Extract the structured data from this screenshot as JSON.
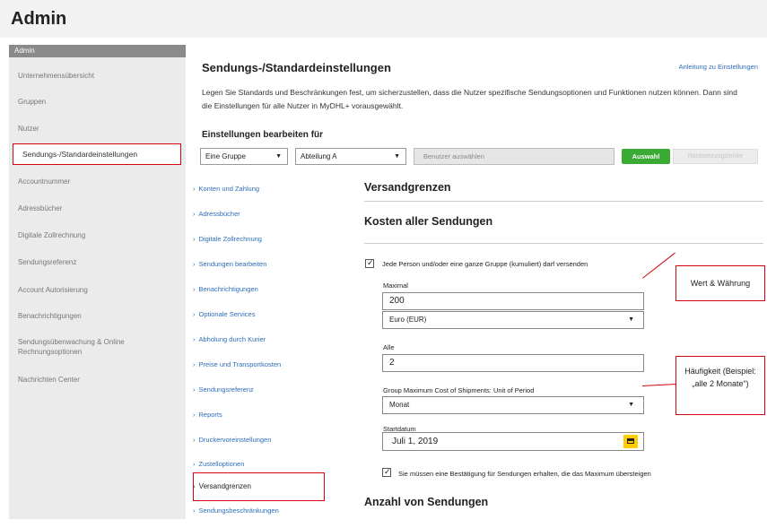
{
  "app": {
    "title": "Admin"
  },
  "sidebar": {
    "header": "Admin",
    "items": [
      {
        "label": "Unternehmensübersicht"
      },
      {
        "label": "Gruppen"
      },
      {
        "label": "Nutzer"
      },
      {
        "label": "Sendungs-/Standardeinstellungen"
      },
      {
        "label": "Accountnummer"
      },
      {
        "label": "Adressbücher"
      },
      {
        "label": "Digitale Zollrechnung"
      },
      {
        "label": "Sendungsreferenz"
      },
      {
        "label": "Account Autorisierung"
      },
      {
        "label": "Benachrichtigungen"
      },
      {
        "label": "Sendungsübenwachung & Online Rechnungsoptionen"
      },
      {
        "label": "Nachrichten Center"
      }
    ]
  },
  "main": {
    "title": "Sendungs-/Standardeinstellungen",
    "help_link": "Anleitung zu Einstellungen",
    "intro": "Legen Sie Standards und Beschränkungen fest, um sicherzustellen, dass die Nutzer spezifische Sendungsoptionen und Funktionen nutzen können. Dann sind die Einstellungen für alle Nutzer in MyDHL+ vorausgewählt.",
    "edit_for": "Einstellungen bearbeiten für",
    "group_select": "Eine Gruppe",
    "dept_select": "Abteilung A",
    "user_placeholder": "Benutzer auswählen",
    "select_button": "Auswahl",
    "reset_button": "Rücksetzungsfehler"
  },
  "subnav": {
    "items": [
      {
        "label": "Konten und Zahlung"
      },
      {
        "label": "Adressbücher"
      },
      {
        "label": "Digitale Zollrechnung"
      },
      {
        "label": "Sendungen bearbeiten"
      },
      {
        "label": "Benachrichtigungen"
      },
      {
        "label": "Optionale Services"
      },
      {
        "label": "Abholung durch Kurier"
      },
      {
        "label": "Preise und Transportkosten"
      },
      {
        "label": "Sendungsreferenz"
      },
      {
        "label": "Reports"
      },
      {
        "label": "Druckervoreinstellungen"
      },
      {
        "label": "Zustelloptionen"
      },
      {
        "label": "Versandgrenzen"
      },
      {
        "label": "Sendungsbeschränkungen"
      }
    ]
  },
  "limits": {
    "title": "Versandgrenzen",
    "cost_title": "Kosten aller Sendungen",
    "cost_checkbox": "Jede Person und/oder eine ganze Gruppe (kumuliert) darf versenden",
    "max_label": "Maximal",
    "max_value": "200",
    "currency": "Euro (EUR)",
    "every_label": "Alle",
    "every_value": "2",
    "period_label": "Group Maximum Cost of Shipments: Unit of Period",
    "period_value": "Monat",
    "start_label": "Startdatum",
    "start_value": "Juli 1, 2019",
    "confirm_checkbox": "Sie müssen eine Bestätigung für Sendungen erhalten, die das Maximum übersteigen",
    "count_title": "Anzahl von Sendungen"
  },
  "callouts": {
    "value_currency": "Wert & Währung",
    "frequency": "Häufigkeit (Beispiel: „alle 2 Monate“)"
  },
  "colors": {
    "accent": "#d40511",
    "link": "#2a6ebb",
    "select_button": "#3aaa35",
    "calendar_button": "#ffcc00"
  }
}
